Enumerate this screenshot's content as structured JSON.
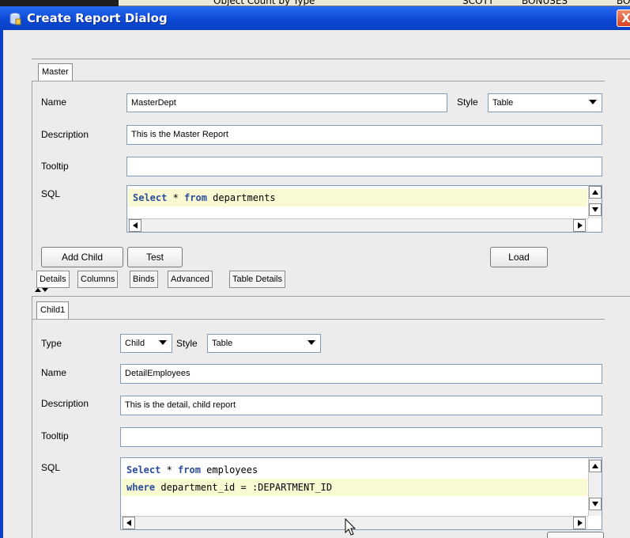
{
  "background_window": {
    "items": [
      "Object Count by Type",
      "SCOTT",
      "BONUSES",
      "BO"
    ]
  },
  "dialog": {
    "title": "Create Report Dialog",
    "close_label": "X"
  },
  "master": {
    "tab_label": "Master",
    "name_label": "Name",
    "name_value": "MasterDept",
    "style_label": "Style",
    "style_value": "Table",
    "description_label": "Description",
    "description_value": "This is the Master Report",
    "tooltip_label": "Tooltip",
    "tooltip_value": "",
    "sql_label": "SQL",
    "sql_line1_kw1": "Select",
    "sql_line1_mid": " * ",
    "sql_line1_kw2": "from",
    "sql_line1_rest": " departments",
    "buttons": {
      "add_child": "Add Child",
      "test": "Test",
      "load": "Load"
    },
    "subtabs": [
      "Details",
      "Columns",
      "Binds",
      "Advanced",
      "Table Details"
    ]
  },
  "child": {
    "tab_label": "Child1",
    "type_label": "Type",
    "type_value": "Child",
    "style_label": "Style",
    "style_value": "Table",
    "name_label": "Name",
    "name_value": "DetailEmployees",
    "description_label": "Description",
    "description_value": "This is the detail, child report",
    "tooltip_label": "Tooltip",
    "tooltip_value": "",
    "sql_label": "SQL",
    "sql_line1_kw1": "Select",
    "sql_line1_mid": " * ",
    "sql_line1_kw2": "from",
    "sql_line1_rest": " employees",
    "sql_line2_kw": "where",
    "sql_line2_rest": " department_id = :DEPARTMENT_ID"
  },
  "colors": {
    "titlebar": "#0b49d6",
    "client_bg": "#ececec",
    "sql_highlight": "#fafad2",
    "sql_keyword": "#2a4d9c"
  }
}
